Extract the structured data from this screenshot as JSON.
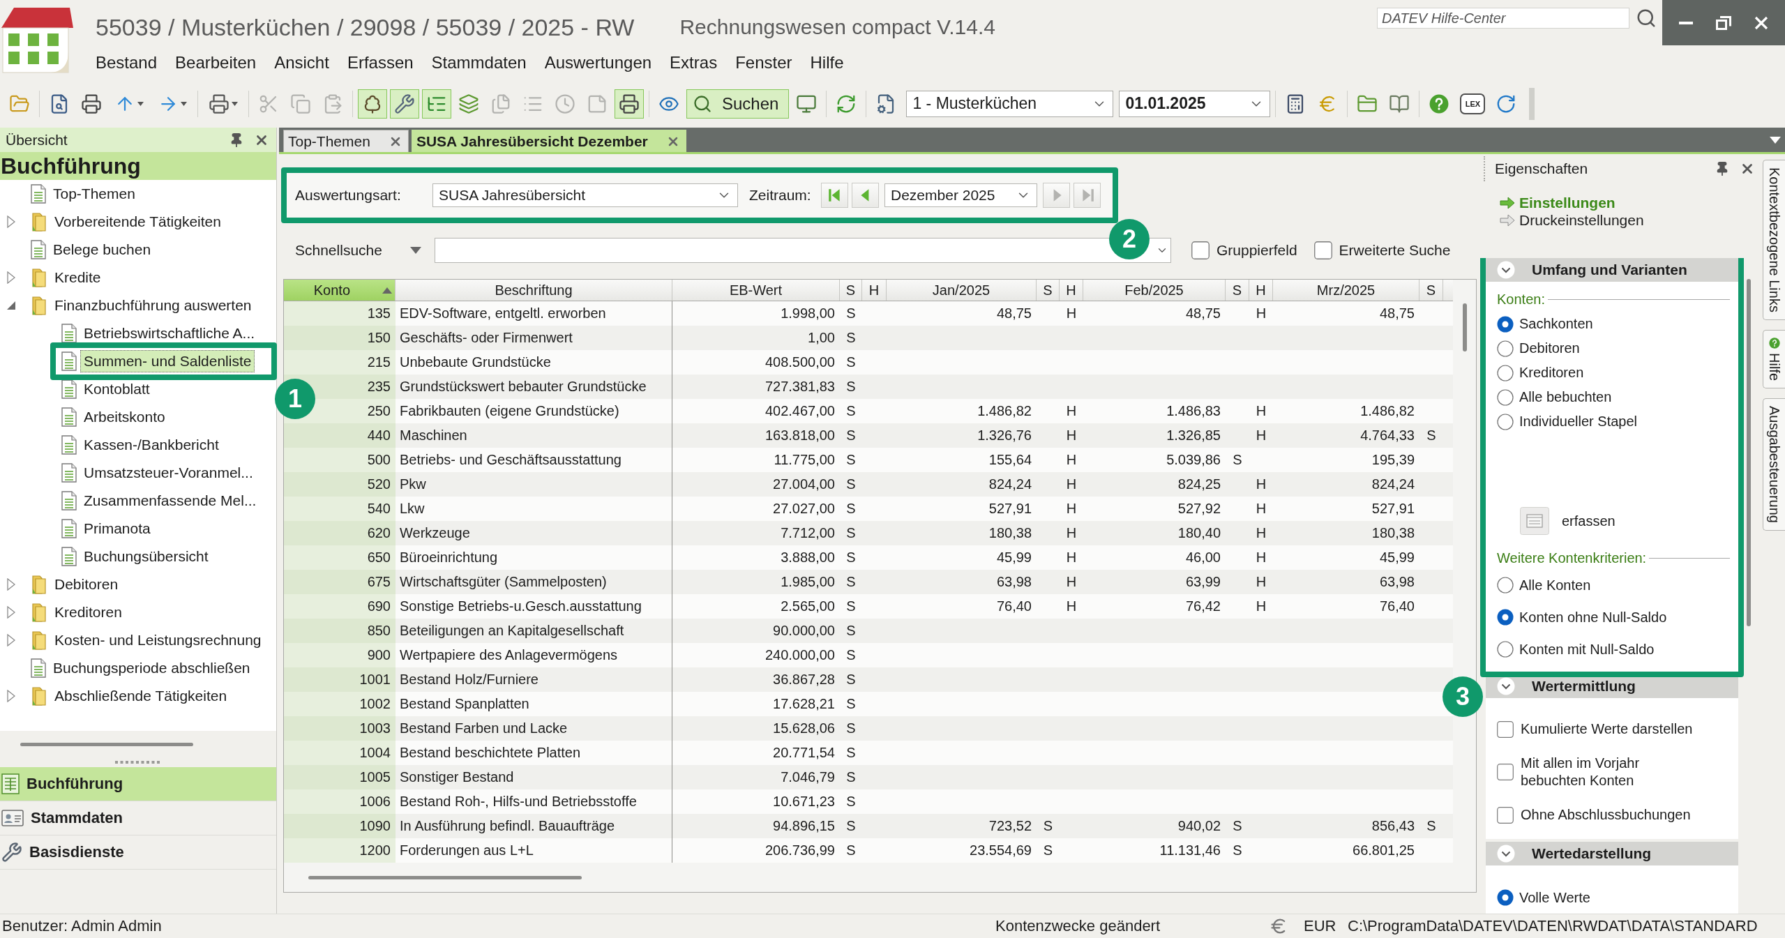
{
  "window": {
    "title": "55039 / Musterküchen / 29098 / 55039 / 2025 - RW",
    "subtitle": "Rechnungswesen compact V.14.4"
  },
  "help_search": {
    "placeholder": "DATEV Hilfe-Center"
  },
  "menu": [
    "Bestand",
    "Bearbeiten",
    "Ansicht",
    "Erfassen",
    "Stammdaten",
    "Auswertungen",
    "Extras",
    "Fenster",
    "Hilfe"
  ],
  "toolbar": [
    {
      "kind": "icon",
      "pressed": false,
      "disabled": false
    },
    {
      "kind": "separator"
    },
    {
      "kind": "icon",
      "pressed": false,
      "disabled": false
    },
    {
      "kind": "icon",
      "pressed": false,
      "disabled": false
    },
    {
      "kind": "icon-menu",
      "pressed": false,
      "disabled": false
    },
    {
      "kind": "icon-menu",
      "pressed": false,
      "disabled": false
    },
    {
      "kind": "separator"
    },
    {
      "kind": "icon-menu",
      "pressed": false,
      "disabled": false
    },
    {
      "kind": "separator"
    },
    {
      "kind": "icon",
      "pressed": false,
      "disabled": true
    },
    {
      "kind": "icon",
      "pressed": false,
      "disabled": true
    },
    {
      "kind": "icon",
      "pressed": false,
      "disabled": true
    },
    {
      "kind": "separator"
    },
    {
      "kind": "icon",
      "pressed": true,
      "disabled": false
    },
    {
      "kind": "icon",
      "pressed": true,
      "disabled": false
    },
    {
      "kind": "icon",
      "pressed": true,
      "disabled": false
    },
    {
      "kind": "icon",
      "pressed": false,
      "disabled": false
    },
    {
      "kind": "icon",
      "pressed": false,
      "disabled": true
    },
    {
      "kind": "icon",
      "pressed": false,
      "disabled": true
    },
    {
      "kind": "icon",
      "pressed": false,
      "disabled": true
    },
    {
      "kind": "icon",
      "pressed": false,
      "disabled": true
    },
    {
      "kind": "icon",
      "pressed": true,
      "disabled": false
    },
    {
      "kind": "separator"
    },
    {
      "kind": "icon",
      "pressed": false,
      "disabled": false
    },
    {
      "kind": "search",
      "label": "Suchen",
      "pressed": true
    },
    {
      "kind": "icon",
      "pressed": false,
      "disabled": false
    },
    {
      "kind": "separator"
    },
    {
      "kind": "icon",
      "pressed": false,
      "disabled": false
    },
    {
      "kind": "separator"
    },
    {
      "kind": "icon",
      "pressed": false,
      "disabled": false
    },
    {
      "kind": "select",
      "value": "1 - Musterküchen"
    },
    {
      "kind": "date",
      "value": "01.01.2025"
    },
    {
      "kind": "separator"
    },
    {
      "kind": "icon",
      "pressed": false,
      "disabled": false
    },
    {
      "kind": "icon",
      "pressed": false,
      "disabled": false
    },
    {
      "kind": "separator"
    },
    {
      "kind": "icon",
      "pressed": false,
      "disabled": false
    },
    {
      "kind": "icon",
      "pressed": false,
      "disabled": false
    },
    {
      "kind": "separator"
    },
    {
      "kind": "icon",
      "pressed": false,
      "disabled": false
    },
    {
      "kind": "badge",
      "label": "LEX"
    },
    {
      "kind": "icon",
      "pressed": false,
      "disabled": false
    }
  ],
  "overview_panel": {
    "title": "Übersicht",
    "section": "Buchführung",
    "tree": [
      {
        "kind": "document",
        "label": "Top-Themen",
        "selected": false
      },
      {
        "kind": "folder",
        "label": "Vorbereitende Tätigkeiten",
        "expanded": false,
        "selected": false
      },
      {
        "kind": "document",
        "label": "Belege buchen",
        "selected": false
      },
      {
        "kind": "folder",
        "label": "Kredite",
        "expanded": false,
        "selected": false
      },
      {
        "kind": "folder",
        "label": "Finanzbuchführung auswerten",
        "expanded": true,
        "selected": false,
        "children": [
          {
            "kind": "document",
            "label": "Betriebswirtschaftliche A...",
            "selected": false
          },
          {
            "kind": "document",
            "label": "Summen- und Saldenliste",
            "selected": true,
            "callout": "1"
          },
          {
            "kind": "document",
            "label": "Kontoblatt",
            "selected": false
          },
          {
            "kind": "document",
            "label": "Arbeitskonto",
            "selected": false
          },
          {
            "kind": "document",
            "label": "Kassen-/Bankbericht",
            "selected": false
          },
          {
            "kind": "document",
            "label": "Umsatzsteuer-Voranmel...",
            "selected": false
          },
          {
            "kind": "document",
            "label": "Zusammenfassende Mel...",
            "selected": false
          },
          {
            "kind": "document",
            "label": "Primanota",
            "selected": false
          },
          {
            "kind": "document",
            "label": "Buchungsübersicht",
            "selected": false
          }
        ]
      },
      {
        "kind": "folder",
        "label": "Debitoren",
        "expanded": false,
        "selected": false
      },
      {
        "kind": "folder",
        "label": "Kreditoren",
        "expanded": false,
        "selected": false
      },
      {
        "kind": "folder",
        "label": "Kosten- und Leistungsrechnung",
        "expanded": false,
        "selected": false
      },
      {
        "kind": "document",
        "label": "Buchungsperiode abschließen",
        "selected": false
      },
      {
        "kind": "folder",
        "label": "Abschließende Tätigkeiten",
        "expanded": false,
        "selected": false
      }
    ],
    "nav": [
      {
        "label": "Buchführung",
        "selected": true
      },
      {
        "label": "Stammdaten",
        "selected": false
      },
      {
        "label": "Basisdienste",
        "selected": false
      }
    ]
  },
  "tabs": [
    {
      "label": "Top-Themen",
      "selected": false
    },
    {
      "label": "SUSA Jahresübersicht Dezember",
      "selected": true
    }
  ],
  "report_filter": {
    "callout": "2",
    "type_label": "Auswertungsart:",
    "type_value": "SUSA Jahresübersicht",
    "period_label": "Zeitraum:",
    "period_value": "Dezember 2025",
    "period_buttons": [
      {
        "disabled": false
      },
      {
        "disabled": false
      },
      {
        "disabled": true
      },
      {
        "disabled": true
      }
    ]
  },
  "quick_search": {
    "label": "Schnellsuche",
    "options": [
      {
        "label": "Gruppierfeld",
        "checked": false
      },
      {
        "label": "Erweiterte Suche",
        "checked": false
      }
    ]
  },
  "table": {
    "columns": [
      {
        "label": "Konto",
        "sorted": true
      },
      {
        "label": "Beschriftung",
        "sorted": false
      },
      {
        "label": "EB-Wert",
        "sorted": false
      },
      {
        "label": "S",
        "sorted": false
      },
      {
        "label": "H",
        "sorted": false
      },
      {
        "label": "Jan/2025",
        "sorted": false
      },
      {
        "label": "S",
        "sorted": false
      },
      {
        "label": "H",
        "sorted": false
      },
      {
        "label": "Feb/2025",
        "sorted": false
      },
      {
        "label": "S",
        "sorted": false
      },
      {
        "label": "H",
        "sorted": false
      },
      {
        "label": "Mrz/2025",
        "sorted": false
      },
      {
        "label": "S",
        "sorted": false
      }
    ],
    "rows": [
      {
        "konto": "135",
        "beschriftung": "EDV-Software, entgeltl. erworben",
        "eb_wert": "1.998,00",
        "eb_s": "S",
        "jan": "48,75",
        "jan_h": "H",
        "feb": "48,75",
        "feb_h": "H",
        "mrz": "48,75"
      },
      {
        "konto": "150",
        "beschriftung": "Geschäfts- oder Firmenwert",
        "eb_wert": "1,00",
        "eb_s": "S"
      },
      {
        "konto": "215",
        "beschriftung": "Unbebaute Grundstücke",
        "eb_wert": "408.500,00",
        "eb_s": "S"
      },
      {
        "konto": "235",
        "beschriftung": "Grundstückswert bebauter Grundstücke",
        "eb_wert": "727.381,83",
        "eb_s": "S"
      },
      {
        "konto": "250",
        "beschriftung": "Fabrikbauten (eigene Grundstücke)",
        "eb_wert": "402.467,00",
        "eb_s": "S",
        "jan": "1.486,82",
        "jan_h": "H",
        "feb": "1.486,83",
        "feb_h": "H",
        "mrz": "1.486,82"
      },
      {
        "konto": "440",
        "beschriftung": "Maschinen",
        "eb_wert": "163.818,00",
        "eb_s": "S",
        "jan": "1.326,76",
        "jan_h": "H",
        "feb": "1.326,85",
        "feb_h": "H",
        "mrz": "4.764,33",
        "mrz_s": "S"
      },
      {
        "konto": "500",
        "beschriftung": "Betriebs- und Geschäftsausstattung",
        "eb_wert": "11.775,00",
        "eb_s": "S",
        "jan": "155,64",
        "jan_h": "H",
        "feb": "5.039,86",
        "feb_s": "S",
        "mrz": "195,39"
      },
      {
        "konto": "520",
        "beschriftung": "Pkw",
        "eb_wert": "27.004,00",
        "eb_s": "S",
        "jan": "824,24",
        "jan_h": "H",
        "feb": "824,25",
        "feb_h": "H",
        "mrz": "824,24"
      },
      {
        "konto": "540",
        "beschriftung": "Lkw",
        "eb_wert": "27.027,00",
        "eb_s": "S",
        "jan": "527,91",
        "jan_h": "H",
        "feb": "527,92",
        "feb_h": "H",
        "mrz": "527,91"
      },
      {
        "konto": "620",
        "beschriftung": "Werkzeuge",
        "eb_wert": "7.712,00",
        "eb_s": "S",
        "jan": "180,38",
        "jan_h": "H",
        "feb": "180,40",
        "feb_h": "H",
        "mrz": "180,38"
      },
      {
        "konto": "650",
        "beschriftung": "Büroeinrichtung",
        "eb_wert": "3.888,00",
        "eb_s": "S",
        "jan": "45,99",
        "jan_h": "H",
        "feb": "46,00",
        "feb_h": "H",
        "mrz": "45,99"
      },
      {
        "konto": "675",
        "beschriftung": "Wirtschaftsgüter (Sammelposten)",
        "eb_wert": "1.985,00",
        "eb_s": "S",
        "jan": "63,98",
        "jan_h": "H",
        "feb": "63,99",
        "feb_h": "H",
        "mrz": "63,98"
      },
      {
        "konto": "690",
        "beschriftung": "Sonstige Betriebs-u.Gesch.ausstattung",
        "eb_wert": "2.565,00",
        "eb_s": "S",
        "jan": "76,40",
        "jan_h": "H",
        "feb": "76,42",
        "feb_h": "H",
        "mrz": "76,40"
      },
      {
        "konto": "850",
        "beschriftung": "Beteiligungen an Kapitalgesellschaft",
        "eb_wert": "90.000,00",
        "eb_s": "S"
      },
      {
        "konto": "900",
        "beschriftung": "Wertpapiere des Anlagevermögens",
        "eb_wert": "240.000,00",
        "eb_s": "S"
      },
      {
        "konto": "1001",
        "beschriftung": "Bestand Holz/Furniere",
        "eb_wert": "36.867,28",
        "eb_s": "S"
      },
      {
        "konto": "1002",
        "beschriftung": "Bestand Spanplatten",
        "eb_wert": "17.628,21",
        "eb_s": "S"
      },
      {
        "konto": "1003",
        "beschriftung": "Bestand Farben und Lacke",
        "eb_wert": "15.628,06",
        "eb_s": "S"
      },
      {
        "konto": "1004",
        "beschriftung": "Bestand beschichtete Platten",
        "eb_wert": "20.771,54",
        "eb_s": "S"
      },
      {
        "konto": "1005",
        "beschriftung": "Sonstiger Bestand",
        "eb_wert": "7.046,79",
        "eb_s": "S"
      },
      {
        "konto": "1006",
        "beschriftung": "Bestand Roh-, Hilfs-und Betriebsstoffe",
        "eb_wert": "10.671,23",
        "eb_s": "S"
      },
      {
        "konto": "1090",
        "beschriftung": "In Ausführung befindl. Bauaufträge",
        "eb_wert": "94.896,15",
        "eb_s": "S",
        "jan": "723,52",
        "jan_s": "S",
        "feb": "940,02",
        "feb_s": "S",
        "mrz": "856,43",
        "mrz_s": "S"
      },
      {
        "konto": "1200",
        "beschriftung": "Forderungen aus L+L",
        "eb_wert": "206.736,99",
        "eb_s": "S",
        "jan": "23.554,69",
        "jan_s": "S",
        "feb": "11.131,46",
        "feb_s": "S",
        "mrz": "66.801,25"
      }
    ]
  },
  "properties_panel": {
    "title": "Eigenschaften",
    "links": [
      {
        "label": "Einstellungen",
        "selected": true
      },
      {
        "label": "Druckeinstellungen",
        "selected": false
      }
    ],
    "sections": [
      {
        "title": "Umfang und Varianten",
        "expanded": true,
        "callout": "3",
        "groups": [
          {
            "kind": "radio",
            "label": "Konten:",
            "options": [
              {
                "label": "Sachkonten",
                "selected": true
              },
              {
                "label": "Debitoren",
                "selected": false
              },
              {
                "label": "Kreditoren",
                "selected": false
              },
              {
                "label": "Alle bebuchten",
                "selected": false
              },
              {
                "label": "Individueller Stapel",
                "selected": false
              }
            ]
          },
          {
            "kind": "action",
            "label": "erfassen"
          },
          {
            "kind": "radio",
            "label": "Weitere Kontenkriterien:",
            "options": [
              {
                "label": "Alle Konten",
                "selected": false
              },
              {
                "label": "Konten ohne Null-Saldo",
                "selected": true
              },
              {
                "label": "Konten mit Null-Saldo",
                "selected": false
              }
            ]
          }
        ]
      },
      {
        "title": "Wertermittlung",
        "expanded": true,
        "groups": [
          {
            "kind": "checkbox",
            "options": [
              {
                "label": "Kumulierte Werte darstellen",
                "checked": false
              },
              {
                "label": "Mit allen im Vorjahr\nbebuchten Konten",
                "checked": false
              },
              {
                "label": "Ohne Abschlussbuchungen",
                "checked": false
              }
            ]
          }
        ]
      },
      {
        "title": "Wertedarstellung",
        "expanded": true,
        "groups": [
          {
            "kind": "radio",
            "options": [
              {
                "label": "Volle Werte",
                "selected": true
              }
            ]
          }
        ]
      }
    ]
  },
  "side_tabs": [
    {
      "label": "Kontextbezogene Links"
    },
    {
      "label": "Hilfe"
    },
    {
      "label": "Ausgabesteuerung"
    }
  ],
  "status_bar": {
    "user": "Benutzer: Admin Admin",
    "message": "Kontenzwecke geändert",
    "currency": "EUR",
    "path": "C:\\ProgramData\\DATEV\\DATEN\\RWDAT\\DATA\\STANDARD"
  }
}
